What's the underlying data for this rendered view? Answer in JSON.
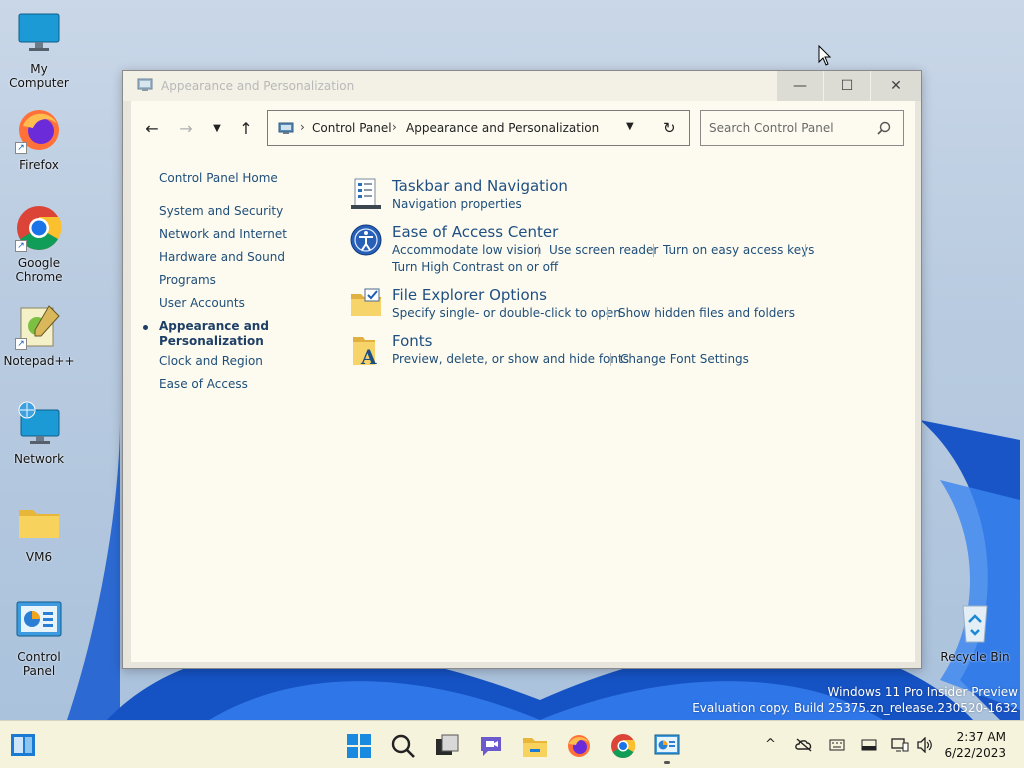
{
  "desktop": {
    "icons": [
      {
        "label": "My Computer",
        "icon": "monitor-icon"
      },
      {
        "label": "Firefox",
        "icon": "firefox-icon"
      },
      {
        "label": "Google Chrome",
        "icon": "chrome-icon"
      },
      {
        "label": "Notepad++",
        "icon": "notepadpp-icon"
      },
      {
        "label": "Network",
        "icon": "network-icon"
      },
      {
        "label": "VM6",
        "icon": "folder-icon"
      },
      {
        "label": "Control Panel",
        "icon": "control-panel-icon"
      },
      {
        "label": "Recycle Bin",
        "icon": "recycle-bin-icon"
      }
    ]
  },
  "window": {
    "title": "Appearance and Personalization",
    "address": {
      "crumbs": [
        "Control Panel",
        "Appearance and Personalization"
      ]
    },
    "search": {
      "placeholder": "Search Control Panel"
    },
    "leftnav": {
      "home": "Control Panel Home",
      "items": [
        "System and Security",
        "Network and Internet",
        "Hardware and Sound",
        "Programs",
        "User Accounts",
        "Appearance and Personalization",
        "Clock and Region",
        "Ease of Access"
      ],
      "current_index": 5
    },
    "categories": [
      {
        "title": "Taskbar and Navigation",
        "links": [
          "Navigation properties"
        ]
      },
      {
        "title": "Ease of Access Center",
        "links": [
          "Accommodate low vision",
          "Use screen reader",
          "Turn on easy access keys",
          "Turn High Contrast on or off"
        ]
      },
      {
        "title": "File Explorer Options",
        "links": [
          "Specify single- or double-click to open",
          "Show hidden files and folders"
        ]
      },
      {
        "title": "Fonts",
        "links": [
          "Preview, delete, or show and hide fonts",
          "Change Font Settings"
        ]
      }
    ]
  },
  "watermark": {
    "line1": "Windows 11 Pro Insider Preview",
    "line2": "Evaluation copy. Build 25375.zn_release.230520-1632"
  },
  "taskbar": {
    "time": "2:37 AM",
    "date": "6/22/2023"
  },
  "colors": {
    "link": "#1e4e79",
    "title_link": "#1f4f82",
    "taskbar": "#f6f3dc",
    "window_bg": "#fdfbf0"
  }
}
